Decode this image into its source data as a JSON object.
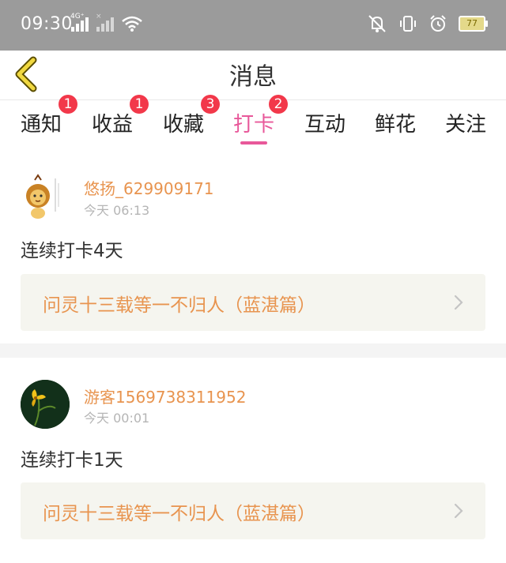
{
  "status_bar": {
    "time": "09:30",
    "network_label": "4G⁺",
    "sim2_label": "×",
    "battery": "77",
    "icons": [
      "signal-icon",
      "wifi-icon",
      "mute-icon",
      "vibrate-icon",
      "alarm-icon",
      "battery-icon"
    ]
  },
  "header": {
    "title": "消息",
    "back_icon": "chevron-left-icon"
  },
  "tabs": [
    {
      "label": "通知",
      "badge": "1"
    },
    {
      "label": "收益",
      "badge": "1"
    },
    {
      "label": "收藏",
      "badge": "3"
    },
    {
      "label": "打卡",
      "badge": "2",
      "active": true
    },
    {
      "label": "互动"
    },
    {
      "label": "鲜花"
    },
    {
      "label": "关注"
    }
  ],
  "colors": {
    "accent": "#e8589a",
    "badge": "#f2384a",
    "username": "#e8944f",
    "book_link_bg": "#f5f5ef"
  },
  "items": [
    {
      "username": "悠扬_629909171",
      "time": "今天 06:13",
      "message": "连续打卡4天",
      "book": "问灵十三载等一不归人（蓝湛篇）",
      "avatar": "lion-cartoon-avatar"
    },
    {
      "username": "游客1569738311952",
      "time": "今天 00:01",
      "message": "连续打卡1天",
      "book": "问灵十三载等一不归人（蓝湛篇）",
      "avatar": "orchid-avatar"
    }
  ]
}
